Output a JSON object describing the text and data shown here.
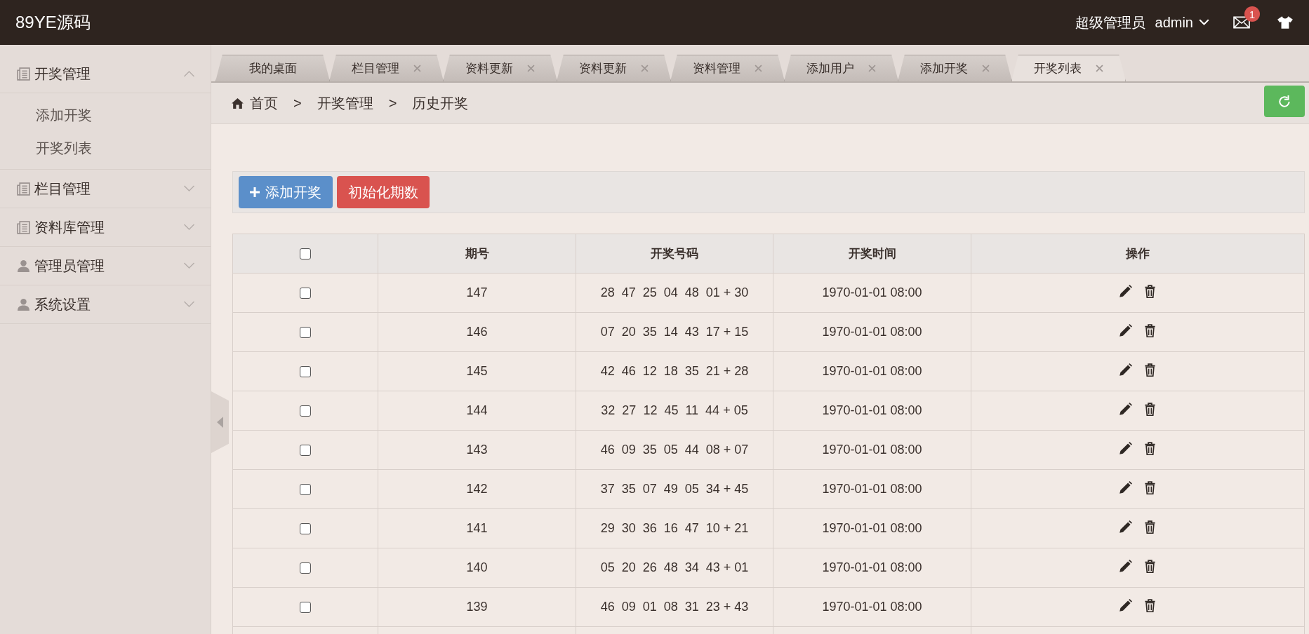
{
  "header": {
    "brand": "89YE源码",
    "role": "超级管理员",
    "user": "admin",
    "mail_badge": "1"
  },
  "sidebar": {
    "groups": [
      {
        "label": "开奖管理",
        "kind": "news",
        "expanded": true,
        "children": [
          {
            "label": "添加开奖"
          },
          {
            "label": "开奖列表"
          }
        ]
      },
      {
        "label": "栏目管理",
        "kind": "news",
        "expanded": false
      },
      {
        "label": "资料库管理",
        "kind": "news",
        "expanded": false
      },
      {
        "label": "管理员管理",
        "kind": "user",
        "expanded": false
      },
      {
        "label": "系统设置",
        "kind": "user",
        "expanded": false
      }
    ]
  },
  "tabs": [
    {
      "label": "我的桌面",
      "selected": false,
      "closable": false
    },
    {
      "label": "栏目管理",
      "selected": false,
      "closable": true
    },
    {
      "label": "资料更新",
      "selected": false,
      "closable": true
    },
    {
      "label": "资料更新",
      "selected": false,
      "closable": true
    },
    {
      "label": "资料管理",
      "selected": false,
      "closable": true
    },
    {
      "label": "添加用户",
      "selected": false,
      "closable": true
    },
    {
      "label": "添加开奖",
      "selected": false,
      "closable": true
    },
    {
      "label": "开奖列表",
      "selected": true,
      "closable": true
    }
  ],
  "breadcrumb": [
    "首页",
    "开奖管理",
    "历史开奖"
  ],
  "breadcrumb_separator": ">",
  "toolbar": {
    "add_button": "添加开奖",
    "reset_button": "初始化期数"
  },
  "table": {
    "columns": [
      "期号",
      "开奖号码",
      "开奖时间",
      "操作"
    ],
    "header_checked": false,
    "rows": [
      {
        "checked": false,
        "issue": "147",
        "numbers": "28  47  25  04  48  01 + 30",
        "time": "1970-01-01 08:00"
      },
      {
        "checked": false,
        "issue": "146",
        "numbers": "07  20  35  14  43  17 + 15",
        "time": "1970-01-01 08:00"
      },
      {
        "checked": false,
        "issue": "145",
        "numbers": "42  46  12  18  35  21 + 28",
        "time": "1970-01-01 08:00"
      },
      {
        "checked": false,
        "issue": "144",
        "numbers": "32  27  12  45  11  44 + 05",
        "time": "1970-01-01 08:00"
      },
      {
        "checked": false,
        "issue": "143",
        "numbers": "46  09  35  05  44  08 + 07",
        "time": "1970-01-01 08:00"
      },
      {
        "checked": false,
        "issue": "142",
        "numbers": "37  35  07  49  05  34 + 45",
        "time": "1970-01-01 08:00"
      },
      {
        "checked": false,
        "issue": "141",
        "numbers": "29  30  36  16  47  10 + 21",
        "time": "1970-01-01 08:00"
      },
      {
        "checked": false,
        "issue": "140",
        "numbers": "05  20  26  48  34  43 + 01",
        "time": "1970-01-01 08:00"
      },
      {
        "checked": false,
        "issue": "139",
        "numbers": "46  09  01  08  31  23 + 43",
        "time": "1970-01-01 08:00"
      }
    ]
  }
}
